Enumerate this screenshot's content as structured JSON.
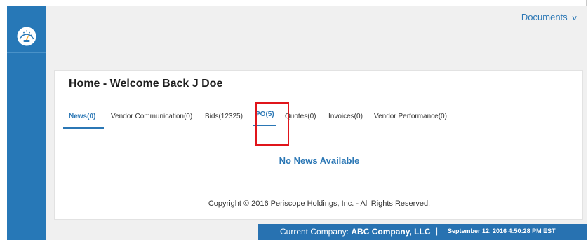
{
  "header": {
    "documents_menu_label": "Documents",
    "documents_menu_icon": "chevron-down-icon"
  },
  "sidebar": {
    "icon": "dashboard-gauge-icon"
  },
  "page": {
    "title": "Home - Welcome Back J Doe"
  },
  "tabs": [
    {
      "label": "News(0)",
      "active": true
    },
    {
      "label": "Vendor Communication(0)",
      "active": false
    },
    {
      "label": "Bids(12325)",
      "active": false
    },
    {
      "label": "PO(5)",
      "active": false
    },
    {
      "label": "Quotes(0)",
      "active": false
    },
    {
      "label": "Invoices(0)",
      "active": false
    },
    {
      "label": "Vendor Performance(0)",
      "active": false
    }
  ],
  "content": {
    "empty_message": "No News Available",
    "copyright": "Copyright © 2016 Periscope Holdings, Inc. - All Rights Reserved."
  },
  "status_bar": {
    "label": "Current Company:",
    "company": "ABC Company, LLC",
    "separator": "|",
    "datetime": "September 12, 2016 4:50:28 PM EST"
  },
  "colors": {
    "accent": "#2b77b5",
    "sidebar": "#2778b7",
    "highlight": "#e0151b"
  }
}
